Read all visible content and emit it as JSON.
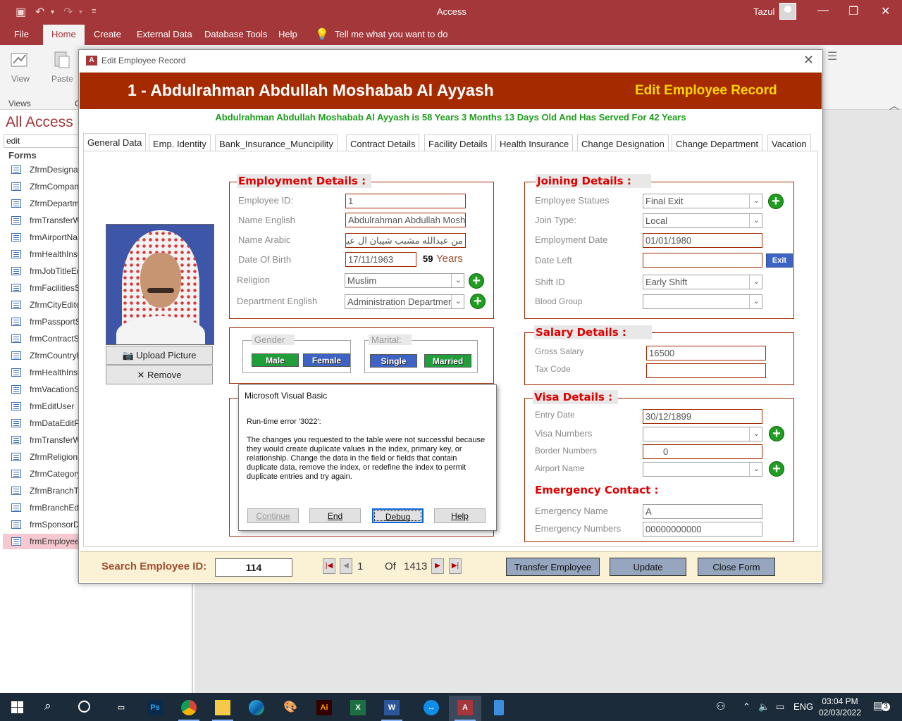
{
  "app": {
    "title": "Access",
    "user": "Tazul",
    "menu": [
      "File",
      "Home",
      "Create",
      "External Data",
      "Database Tools",
      "Help"
    ],
    "tell_me": "Tell me what you want to do"
  },
  "ribbon": {
    "view_label": "View",
    "paste_label": "Paste",
    "views_group": "Views",
    "clipboard_group_partial": "C"
  },
  "nav": {
    "title": "All Access (",
    "search_value": "edit",
    "group": "Forms",
    "items": [
      "ZfrmDesignat",
      "ZfrmCompani",
      "ZfrmDepartm",
      "frmTransferW",
      "frmAirportNa",
      "frmHealthInsu",
      "frmJobTitleEd",
      "frmFacilitiesS",
      "ZfrmCityEdito",
      "frmPassportS",
      "frmContractS",
      "ZfrmCountryE",
      "frmHealthInsu",
      "frmVacationS",
      "frmEditUser",
      "frmDataEditPa",
      "frmTransferW",
      "ZfrmReligionE",
      "ZfrmCategory",
      "ZfrmBranchTy",
      "frmBranchEdit",
      "frmSponsorDe",
      "frmEmployeeE"
    ],
    "selected_index": 22
  },
  "form": {
    "window_title": "Edit Employee Record",
    "employee_heading": "1 - Abdulrahman Abdullah Moshabab Al Ayyash",
    "form_heading": "Edit Employee Record",
    "age_line": "Abdulrahman Abdullah Moshabab Al Ayyash is 58 Years 3 Months 13 Days Old And Has Served For 42 Years",
    "tabs": [
      "General Data",
      "Emp. Identity",
      "Bank_Insurance_Muncipility",
      "Contract Details",
      "Facility Details",
      "Health Insurance",
      "Change Designation",
      "Change Department",
      "Vacation"
    ],
    "active_tab": 0,
    "photo_buttons": {
      "upload": "Upload Picture",
      "remove": "Remove"
    },
    "employment": {
      "title": "Employment Details :",
      "employee_id_label": "Employee ID:",
      "employee_id": "1",
      "name_en_label": "Name English",
      "name_en": "Abdulrahman Abdullah Moshabab Al Ayyash",
      "name_ar_label": "Name Arabic",
      "name_ar": "من عبدالله مشبب شيبان ال عياش",
      "dob_label": "Date Of Birth",
      "dob": "17/11/1963",
      "age_num": "59",
      "age_unit": "Years",
      "religion_label": "Religion",
      "religion": "Muslim",
      "department_label": "Department English",
      "department": "Administration Department"
    },
    "gender_marital": {
      "gender_label": "Gender",
      "male": "Male",
      "female": "Female",
      "marital_label": "Marital:",
      "single": "Single",
      "married": "Married"
    },
    "joining": {
      "title": "Joining Details  :",
      "status_label": "Employee Statues",
      "status": "Final Exit",
      "join_type_label": "Join Type:",
      "join_type": "Local",
      "employment_date_label": "Employment Date",
      "employment_date": "01/01/1980",
      "date_left_label": "Date Left",
      "date_left": "",
      "exit_button": "Exit",
      "shift_label": "Shift ID",
      "shift": "Early Shift",
      "blood_label": "Blood Group",
      "blood": ""
    },
    "salary": {
      "title": "Salary Details :",
      "gross_label": "Gross Salary",
      "gross": "16500",
      "tax_label": "Tax Code",
      "tax": ""
    },
    "visa": {
      "title": "Visa Details :",
      "entry_label": "Entry Date",
      "entry": "30/12/1899",
      "visa_no_label": "Visa Numbers",
      "visa_no": "",
      "border_label": "Border Numbers",
      "border": "0",
      "airport_label": "Airport Name",
      "airport": ""
    },
    "emergency": {
      "title": "Emergency Contact :",
      "name_label": "Emergency Name",
      "name": "A",
      "numbers_label": "Emergency Numbers",
      "numbers": "00000000000"
    },
    "footer": {
      "search_label": "Search Employee ID:",
      "search_value": "114",
      "record_current": "1",
      "record_of": "Of",
      "record_total": "1413",
      "transfer_button": "Transfer Employee",
      "update_button": "Update",
      "close_button": "Close Form"
    }
  },
  "dialog": {
    "title": "Microsoft Visual Basic",
    "error": "Run-time error '3022':",
    "message": "The changes you requested to the table were not successful because they would create duplicate values in the index, primary key, or relationship. Change the data in the field or fields that contain duplicate data, remove the index, or redefine the index to permit duplicate entries and try again.",
    "buttons": {
      "continue": "Continue",
      "end": "End",
      "debug": "Debug",
      "help": "Help"
    }
  },
  "taskbar": {
    "language": "ENG",
    "time": "03:04 PM",
    "date": "02/03/2022",
    "notifications": "3",
    "apps": [
      "task-view-icon",
      "file-manager-icon",
      "photoshop-icon",
      "chrome-icon",
      "file-explorer-icon",
      "edge-icon",
      "paint-icon",
      "illustrator-icon",
      "excel-icon",
      "word-icon",
      "teamviewer-icon",
      "access-icon",
      "phone-icon"
    ]
  },
  "colors": {
    "access_red": "#a4373a",
    "header_band": "#a52a00",
    "form_title_gold": "#ffd700",
    "age_green": "#1e9e1e",
    "group_title_red": "#e00000",
    "footer_bg": "#fbf1d5"
  }
}
